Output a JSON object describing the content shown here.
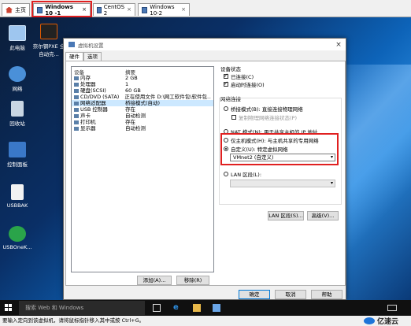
{
  "tabs": [
    {
      "label": "主页",
      "icon": "home-icon"
    },
    {
      "label": "Windows 10 -1",
      "icon": "vm-icon",
      "active": true
    },
    {
      "label": "CentOS 2",
      "icon": "vm-icon"
    },
    {
      "label": "Windows 10-2",
      "icon": "vm-icon"
    }
  ],
  "desktop_icons": [
    {
      "label": "此电脑",
      "icon": "computer-icon"
    },
    {
      "label": "奈尔钢PXE 全自动完...",
      "icon": "pxe-icon"
    },
    {
      "label": "网络",
      "icon": "network-icon"
    },
    {
      "label": "回收站",
      "icon": "recycle-bin-icon"
    },
    {
      "label": "控制面板",
      "icon": "control-panel-icon"
    },
    {
      "label": "USBBAK",
      "icon": "usb-icon"
    },
    {
      "label": "USBOneK...",
      "icon": "usb-onekey-icon"
    }
  ],
  "dialog": {
    "title": "虚拟机设置",
    "tabs": [
      "硬件",
      "选项"
    ],
    "columns": [
      "设备",
      "摘要"
    ],
    "devices": [
      {
        "name": "内存",
        "summary": "2 GB"
      },
      {
        "name": "处理器",
        "summary": "1"
      },
      {
        "name": "硬盘(SCSI)",
        "summary": "60 GB"
      },
      {
        "name": "CD/DVD (SATA)",
        "summary": "正在使用文件 D:\\网工软件包\\软件包..."
      },
      {
        "name": "网络适配器",
        "summary": "桥接模式(自动)",
        "selected": true
      },
      {
        "name": "USB 控制器",
        "summary": "存在"
      },
      {
        "name": "声卡",
        "summary": "自动检测"
      },
      {
        "name": "打印机",
        "summary": "存在"
      },
      {
        "name": "显示器",
        "summary": "自动检测"
      }
    ],
    "add_button": "添加(A)...",
    "remove_button": "移除(R)",
    "device_status": {
      "title": "设备状态",
      "connected": "已连接(C)",
      "connect_on_power": "启动时连接(O)"
    },
    "network": {
      "title": "网络连接",
      "bridged": "桥接模式(B): 直接连接物理网络",
      "replicate": "复制物理网络连接状态(P)",
      "nat": "NAT 模式(N): 用于共享主机的 IP 地址",
      "hostonly": "仅主机模式(H): 与主机共享的专用网络",
      "custom": "自定义(U): 特定虚拟网络",
      "custom_value": "VMnet2 (自定义)",
      "lan": "LAN 区段(L):",
      "lan_value": ""
    },
    "lan_button": "LAN 区段(S)...",
    "advanced_button": "高级(V)...",
    "ok": "确定",
    "cancel": "取消",
    "help": "帮助"
  },
  "taskbar": {
    "search_placeholder": "搜索 Web 和 Windows"
  },
  "status_text": "要输入定向到该虚拟机，请将鼠标指针移入其中或按 Ctrl+G。",
  "brand": "亿速云",
  "colors": {
    "highlight": "#e02020",
    "selection": "#cce8ff"
  }
}
